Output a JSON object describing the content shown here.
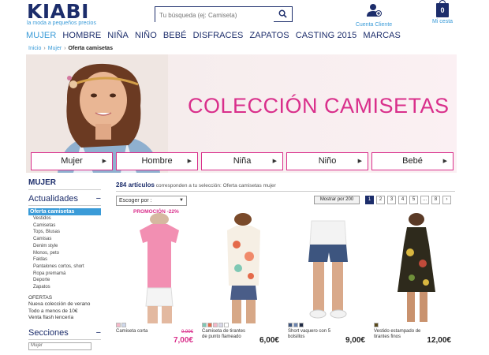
{
  "brand": {
    "name": "KIABI",
    "tagline": "la moda a pequeños precios"
  },
  "search": {
    "placeholder": "Tu búsqueda (ej: Camiseta)"
  },
  "header": {
    "account_label": "Cuenta Cliente",
    "cart_label": "Mi cesta",
    "cart_count": "0"
  },
  "nav": {
    "items": [
      "MUJER",
      "HOMBRE",
      "NIÑA",
      "NIÑO",
      "BEBÉ",
      "DISFRACES",
      "ZAPATOS",
      "CASTING 2015",
      "MARCAS"
    ]
  },
  "breadcrumb": {
    "items": [
      "Inicio",
      "Mujer",
      "Oferta camisetas"
    ]
  },
  "banner": {
    "title": "COLECCIÓN CAMISETAS",
    "buttons": [
      "Mujer",
      "Hombre",
      "Niña",
      "Niño",
      "Bebé"
    ]
  },
  "sidebar": {
    "title": "MUJER",
    "section1": "Actualidades",
    "active": "Oferta camisetas",
    "items": [
      "Vestidos",
      "Camisetas",
      "Tops, Blusas",
      "Camisas",
      "Denim style",
      "Monos, peto",
      "Faldas",
      "Pantalones cortos, short",
      "Ropa premamá",
      "Deporte",
      "Zapatos"
    ],
    "offers": [
      "OFERTAS",
      "Nueva colección de verano",
      "Todo a menos de 10€",
      "Venta flash lencería"
    ],
    "section2": "Secciones",
    "section2_input": "Mujer"
  },
  "results": {
    "count": "284 artículos",
    "text": "corresponden a tu selección: Oferta camisetas mujer"
  },
  "sort": {
    "label": "Escoger por :"
  },
  "pagination": {
    "show_all": "Mostrar por 200",
    "pages": [
      "1",
      "2",
      "3",
      "4",
      "5",
      "...",
      "8",
      "›"
    ]
  },
  "products": [
    {
      "name": "Camiseta corta",
      "price": "7,00€",
      "old_price": "9,99€",
      "promo": "PROMOCIÓN -22%",
      "swatches": [
        "#f4b8c8",
        "#cfd8ec"
      ]
    },
    {
      "name": "Camiseta de tirantes de punto flameado",
      "price": "6,00€",
      "swatches": [
        "#7fc8b4",
        "#e66b4b",
        "#f4b8c8",
        "#d8d8e8",
        "#ffffff"
      ]
    },
    {
      "name": "Short vaquero con 5 bolsillos",
      "price": "9,00€",
      "swatches": [
        "#3e5680",
        "#6b84b0",
        "#1f2a44"
      ]
    },
    {
      "name": "Vestido estampado de tirantes finos",
      "price": "12,00€",
      "swatches": [
        "#5a4a1c"
      ]
    }
  ],
  "colors": {
    "brand_navy": "#1c2d6b",
    "accent_blue": "#3a9bd8",
    "accent_pink": "#d92f8b"
  }
}
